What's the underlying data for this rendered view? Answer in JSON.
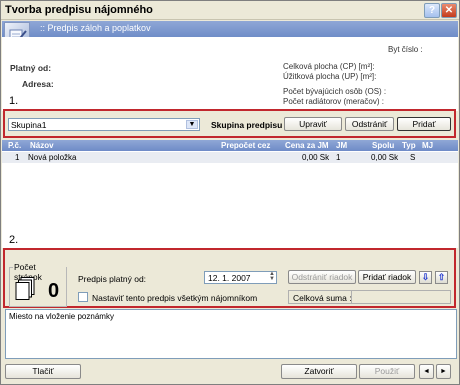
{
  "window": {
    "title": "Tvorba predpisu nájomného"
  },
  "banner": {
    "title": ":: Predpis záloh a poplatkov"
  },
  "info": {
    "byt_cislo": "Byt číslo :",
    "platny_od": "Platný od:",
    "adresa": "Adresa:",
    "celkova_plocha": "Celková plocha (CP) [m²]:",
    "uzitkova_plocha": "Úžitková plocha (UP) [m²]:",
    "pocet_osob": "Počet bývajúcich osôb (OS) :",
    "pocet_radiatorov": "Počet radiátorov (meračov) :"
  },
  "markers": {
    "one": "1.",
    "two": "2."
  },
  "group": {
    "selected": "Skupina1",
    "label": "Skupina predpisu",
    "edit": "Upraviť",
    "remove": "Odstrániť",
    "add": "Pridať"
  },
  "table": {
    "headers": [
      "P.č.",
      "Názov",
      "Prepočet cez",
      "Cena za JM",
      "JM",
      "Spolu",
      "Typ",
      "MJ"
    ],
    "rows": [
      {
        "pc": "1",
        "nazov": "Nová položka",
        "prepocet": "",
        "cena": "0,00 Sk",
        "jm": "1",
        "spolu": "0,00 Sk",
        "typ": "S",
        "mj": ""
      }
    ]
  },
  "pages": {
    "label": "Počet stránok",
    "count": "0"
  },
  "prescription": {
    "valid_from_label": "Predpis platný od:",
    "valid_from_value": "12. 1. 2007",
    "remove_row": "Odstrániť riadok",
    "add_row": "Pridať riadok",
    "set_all_label": "Nastaviť tento predpis všetkým nájomníkom",
    "total_label": "Celková suma :"
  },
  "notes": {
    "placeholder": "Miesto na vloženie poznámky"
  },
  "footer": {
    "print": "Tlačiť",
    "close": "Zatvoriť",
    "use": "Použiť",
    "prev": "◄",
    "next": "►"
  }
}
